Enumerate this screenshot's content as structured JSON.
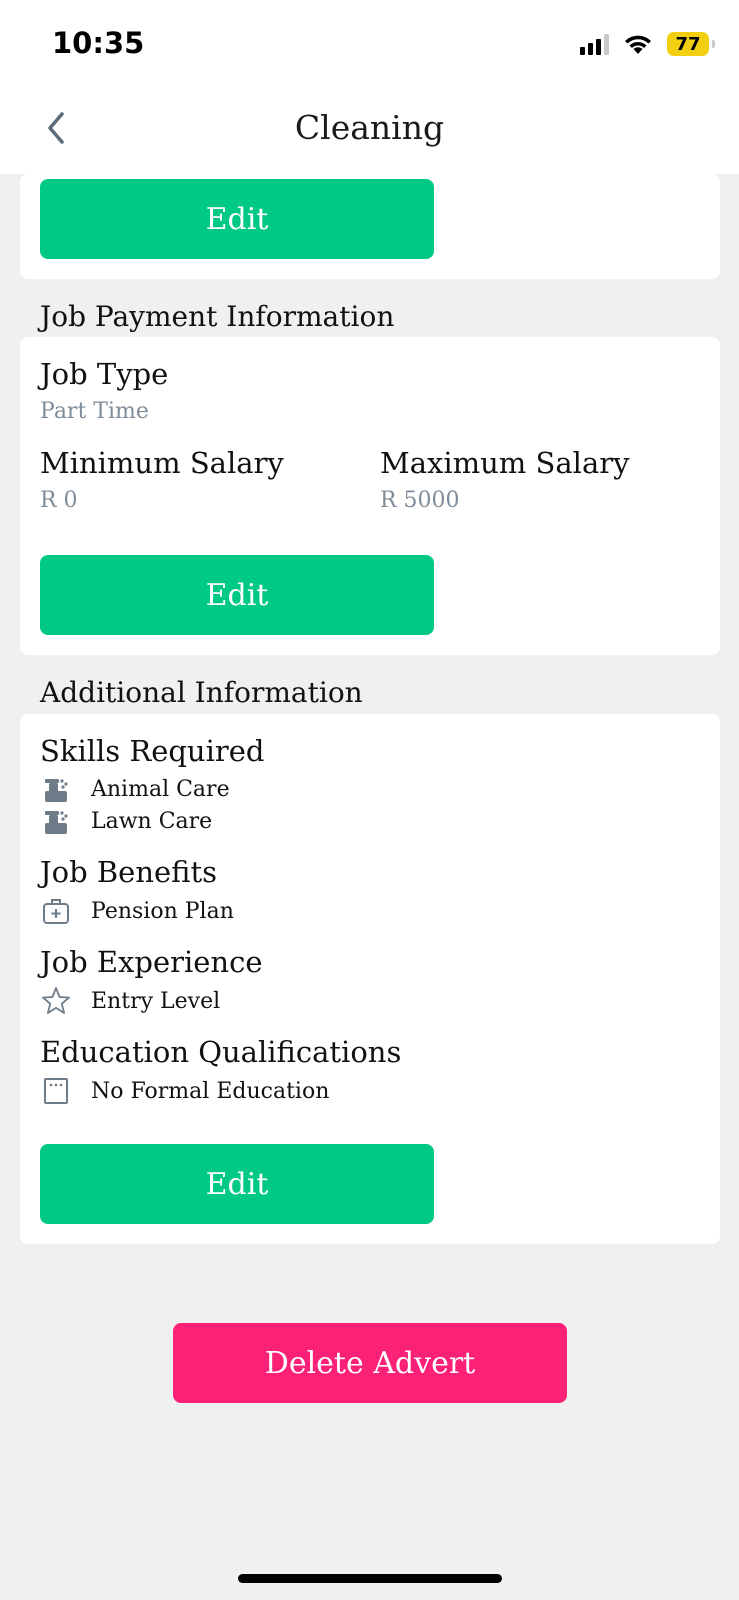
{
  "status_bar": {
    "time": "10:35",
    "battery": "77"
  },
  "nav": {
    "title": "Cleaning"
  },
  "top_card": {
    "edit_label": "Edit"
  },
  "payment": {
    "section_title": "Job Payment Information",
    "job_type_label": "Job Type",
    "job_type_value": "Part Time",
    "min_salary_label": "Minimum Salary",
    "min_salary_value": "R 0",
    "max_salary_label": "Maximum Salary",
    "max_salary_value": "R 5000",
    "edit_label": "Edit"
  },
  "additional": {
    "section_title": "Additional Information",
    "skills_label": "Skills Required",
    "skills": [
      {
        "label": "Animal Care",
        "icon": "cleaning-spray-icon"
      },
      {
        "label": "Lawn Care",
        "icon": "cleaning-spray-icon"
      }
    ],
    "benefits_label": "Job Benefits",
    "benefits": [
      {
        "label": "Pension Plan",
        "icon": "medical-bag-icon"
      }
    ],
    "experience_label": "Job Experience",
    "experience": [
      {
        "label": "Entry Level",
        "icon": "star-icon"
      }
    ],
    "education_label": "Education Qualifications",
    "education": [
      {
        "label": "No Formal Education",
        "icon": "certificate-icon"
      }
    ],
    "edit_label": "Edit"
  },
  "delete_label": "Delete Advert",
  "colors": {
    "accent_green": "#00c885",
    "delete_pink": "#fb2177",
    "muted_text": "#7f8c99"
  }
}
